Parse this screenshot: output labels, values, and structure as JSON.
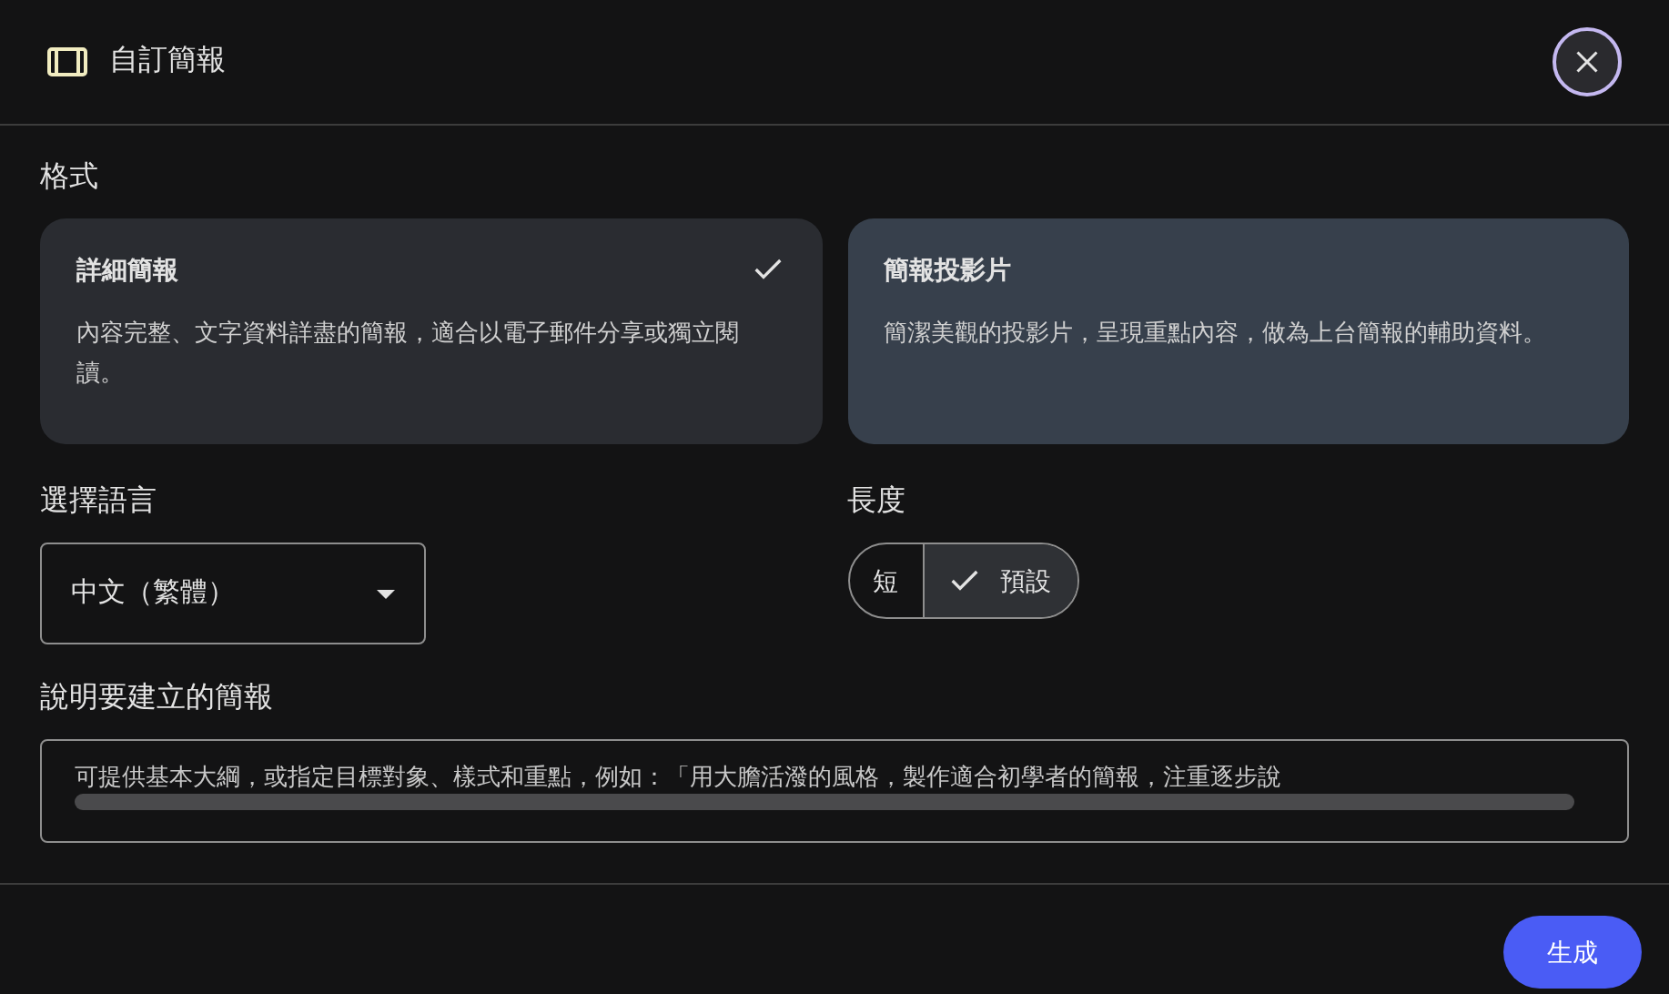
{
  "dialog": {
    "title": "自訂簡報"
  },
  "format": {
    "label": "格式",
    "options": [
      {
        "title": "詳細簡報",
        "description": "內容完整、文字資料詳盡的簡報，適合以電子郵件分享或獨立閱讀。",
        "selected": true
      },
      {
        "title": "簡報投影片",
        "description": "簡潔美觀的投影片，呈現重點內容，做為上台簡報的輔助資料。",
        "selected": false
      }
    ]
  },
  "language": {
    "label": "選擇語言",
    "value": "中文（繁體）"
  },
  "length": {
    "label": "長度",
    "options": [
      {
        "label": "短",
        "selected": false
      },
      {
        "label": "預設",
        "selected": true
      }
    ]
  },
  "description": {
    "label": "說明要建立的簡報",
    "placeholder": "可提供基本大綱，或指定目標對象、樣式和重點，例如：「用大膽活潑的風格，製作適合初學者的簡報，注重逐步說"
  },
  "submit": "生成"
}
